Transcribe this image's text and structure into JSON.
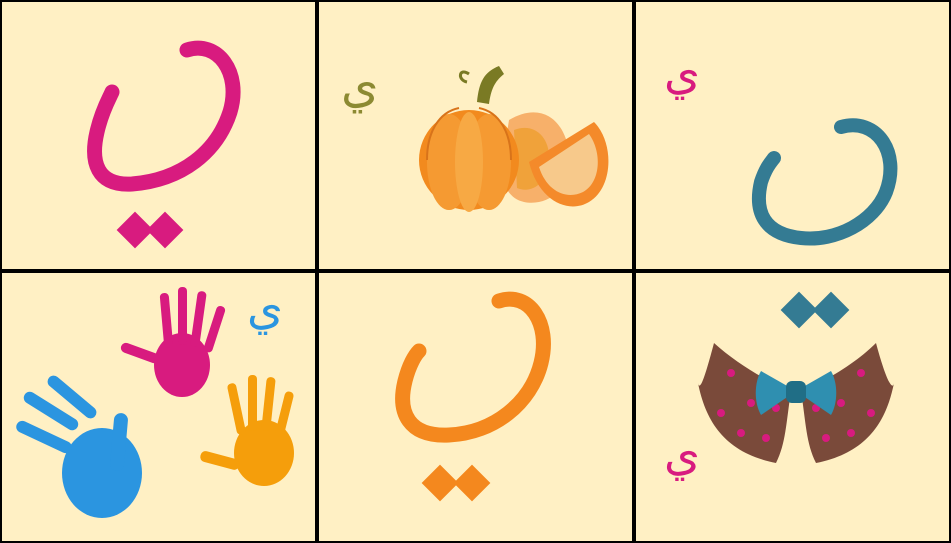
{
  "letter": "ي",
  "colors": {
    "background": "#fff0c4",
    "border": "#000000",
    "pink": "#d81b7f",
    "olive": "#8c8a32",
    "teal": "#347b93",
    "blue": "#2b95e0",
    "orange": "#f4881e"
  },
  "cells": [
    {
      "name": "pink-letter-card",
      "icon": "letter-ya-pink"
    },
    {
      "name": "pumpkin-card",
      "icon": "pumpkin-icon"
    },
    {
      "name": "teal-letter-card",
      "icon": "letter-ya-teal"
    },
    {
      "name": "handprints-card",
      "icon": "handprints-icon"
    },
    {
      "name": "orange-letter-card",
      "icon": "letter-ya-orange"
    },
    {
      "name": "bow-collar-card",
      "icon": "collar-bow-icon"
    }
  ]
}
